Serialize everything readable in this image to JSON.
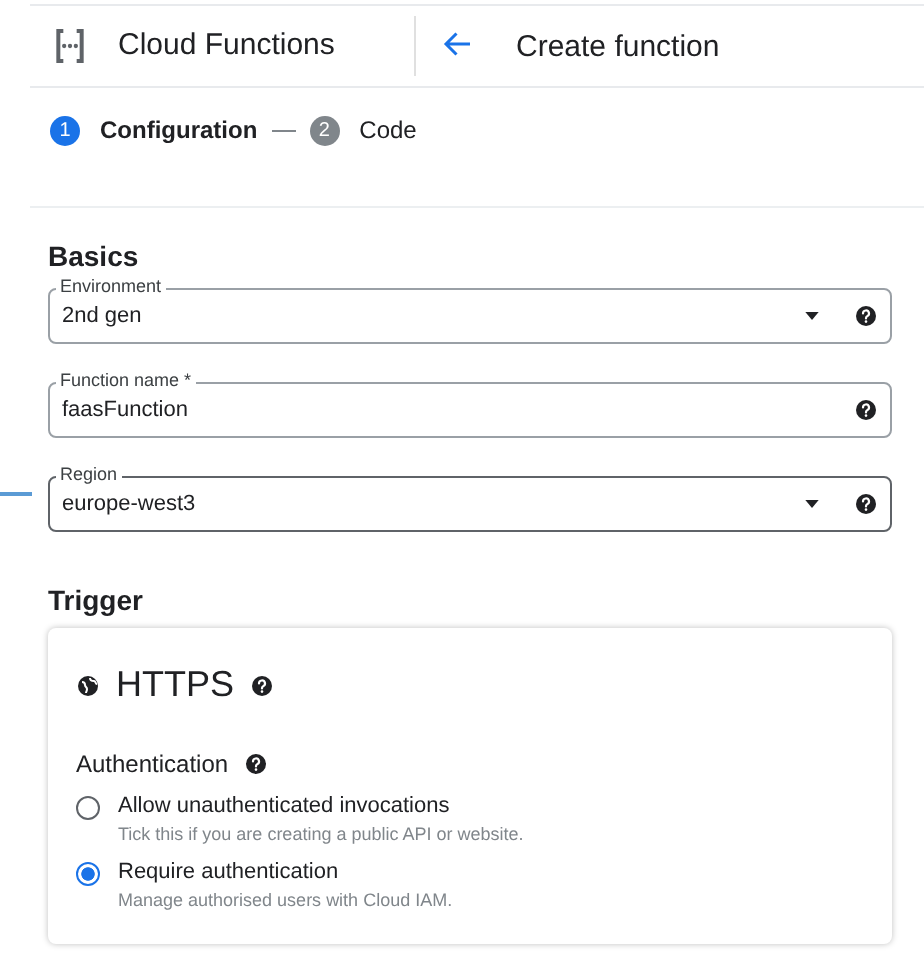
{
  "header": {
    "product": "Cloud Functions",
    "title": "Create function"
  },
  "steps": [
    {
      "number": "1",
      "label": "Configuration",
      "selected": true
    },
    {
      "number": "2",
      "label": "Code",
      "selected": false
    }
  ],
  "basics": {
    "heading": "Basics",
    "fields": [
      {
        "kind": "select",
        "label": "Environment",
        "value": "2nd gen",
        "focused": false
      },
      {
        "kind": "text",
        "label": "Function name *",
        "value": "faasFunction",
        "focused": false
      },
      {
        "kind": "select",
        "label": "Region",
        "value": "europe-west3",
        "focused": true
      }
    ]
  },
  "trigger": {
    "heading": "Trigger",
    "type": "HTTPS",
    "auth_heading": "Authentication",
    "options": [
      {
        "label": "Allow unauthenticated invocations",
        "hint": "Tick this if you are creating a public API or website.",
        "selected": false
      },
      {
        "label": "Require authentication",
        "hint": "Manage authorised users with Cloud IAM.",
        "selected": true
      }
    ]
  }
}
